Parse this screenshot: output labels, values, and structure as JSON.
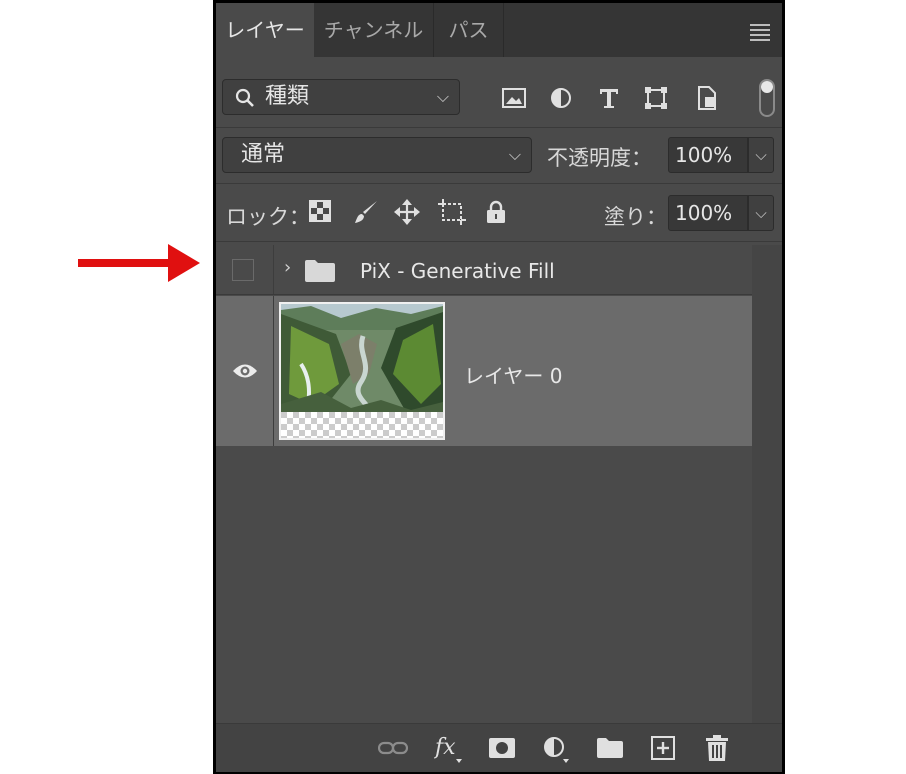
{
  "tabs": [
    {
      "label": "レイヤー",
      "active": true
    },
    {
      "label": "チャンネル",
      "active": false
    },
    {
      "label": "パス",
      "active": false
    }
  ],
  "filter": {
    "kind_label": "種類",
    "icons": [
      "image-icon",
      "adjustment-icon",
      "type-icon",
      "shape-icon",
      "smart-object-icon"
    ]
  },
  "blend": {
    "mode": "通常",
    "opacity_label": "不透明度：",
    "opacity_value": "100%"
  },
  "lock": {
    "label": "ロック：",
    "fill_label": "塗り：",
    "fill_value": "100%"
  },
  "layers": [
    {
      "name": "PiX - Generative Fill",
      "type": "group",
      "visible": false
    },
    {
      "name": "レイヤー 0",
      "type": "pixel",
      "visible": true,
      "selected": true
    }
  ],
  "colors": {
    "panel": "#4a4a4a",
    "tabbar": "#353535",
    "selected": "#6b6b6b",
    "arrow": "#e01010"
  }
}
